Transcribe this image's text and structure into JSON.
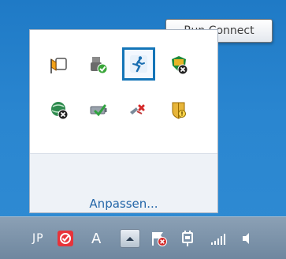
{
  "tooltip": {
    "text": "Run Connect"
  },
  "tray_popup": {
    "customize_label": "Anpassen...",
    "icons": [
      {
        "name": "action-center-flag-icon"
      },
      {
        "name": "safely-remove-hardware-icon"
      },
      {
        "name": "run-connect-icon",
        "selected": true
      },
      {
        "name": "network-security-shield-icon"
      },
      {
        "name": "status-globe-icon"
      },
      {
        "name": "battery-check-icon"
      },
      {
        "name": "network-disconnected-icon"
      },
      {
        "name": "shield-warning-icon"
      }
    ]
  },
  "taskbar": {
    "language": "JP",
    "ime_mode": "A",
    "show_hidden_label": "show hidden icons"
  },
  "colors": {
    "desktop": "#2a86d0",
    "selection_border": "#1475b8",
    "link": "#2466a8",
    "taskbar": "#7b92aa"
  }
}
